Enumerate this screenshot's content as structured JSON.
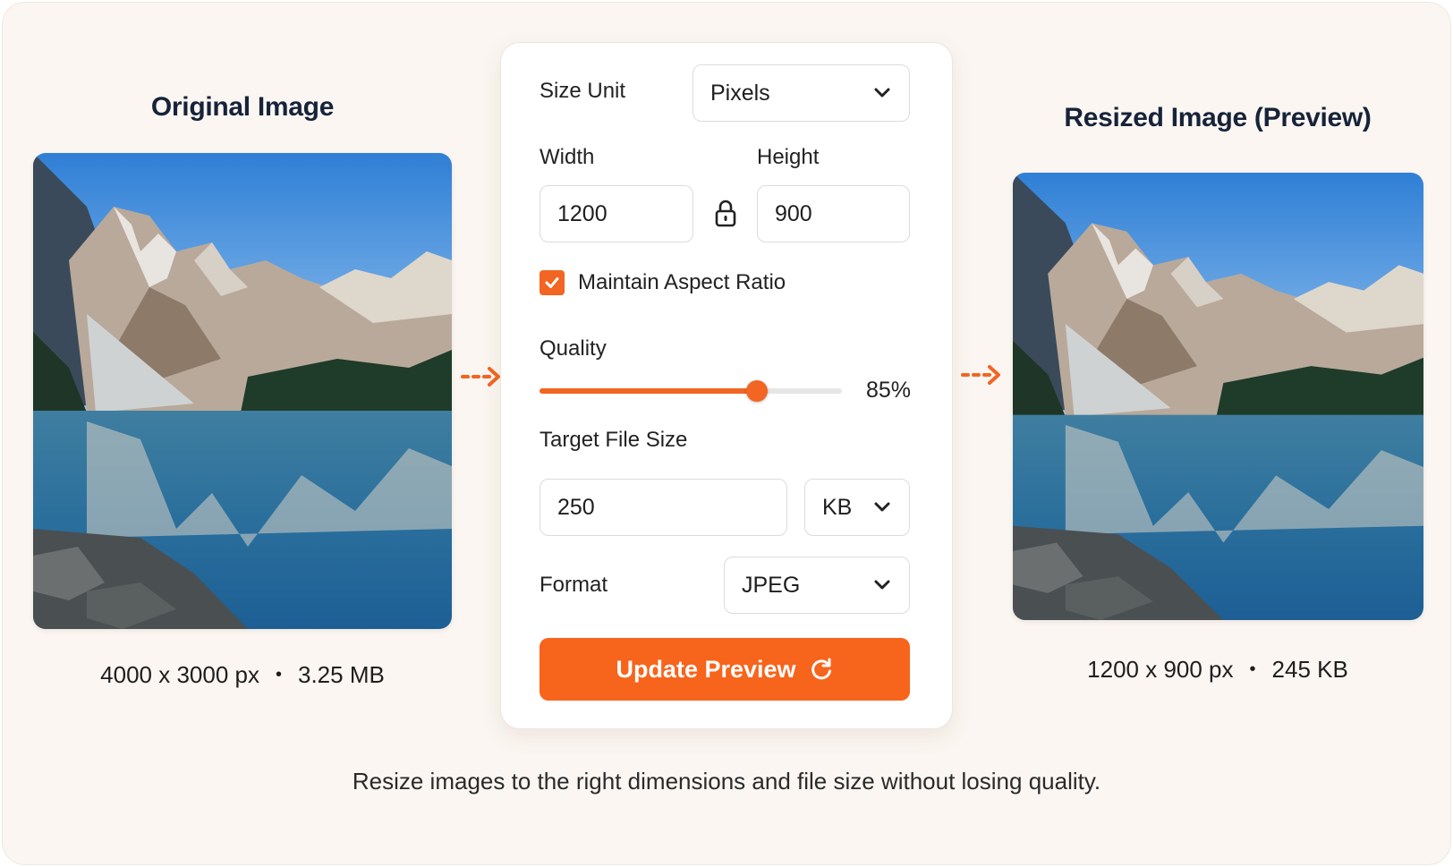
{
  "original": {
    "title": "Original Image",
    "dimensions": "4000 x 3000 px",
    "separator": "•",
    "file_size": "3.25 MB"
  },
  "resized": {
    "title": "Resized Image (Preview)",
    "dimensions": "1200 x 900 px",
    "separator": "•",
    "file_size": "245 KB"
  },
  "panel": {
    "size_unit": {
      "label": "Size Unit",
      "value": "Pixels"
    },
    "width": {
      "label": "Width",
      "value": "1200"
    },
    "height": {
      "label": "Height",
      "value": "900"
    },
    "aspect": {
      "label": "Maintain Aspect Ratio",
      "checked": true
    },
    "quality": {
      "label": "Quality",
      "value_text": "85%",
      "value": 0.72
    },
    "target_size": {
      "label": "Target File Size",
      "value": "250",
      "unit": "KB"
    },
    "format": {
      "label": "Format",
      "value": "JPEG"
    },
    "update_button": {
      "label": "Update Preview"
    }
  },
  "icons": {
    "lock": "lock-icon",
    "check": "check-icon",
    "chevron": "chevron-down-icon",
    "refresh": "refresh-icon",
    "arrow": "dashed-arrow-right-icon"
  },
  "colors": {
    "accent": "#f26522",
    "button": "#f7641c",
    "background": "#fbf6f1",
    "title": "#16233a"
  },
  "tagline": "Resize images to the right dimensions and file size without losing quality."
}
